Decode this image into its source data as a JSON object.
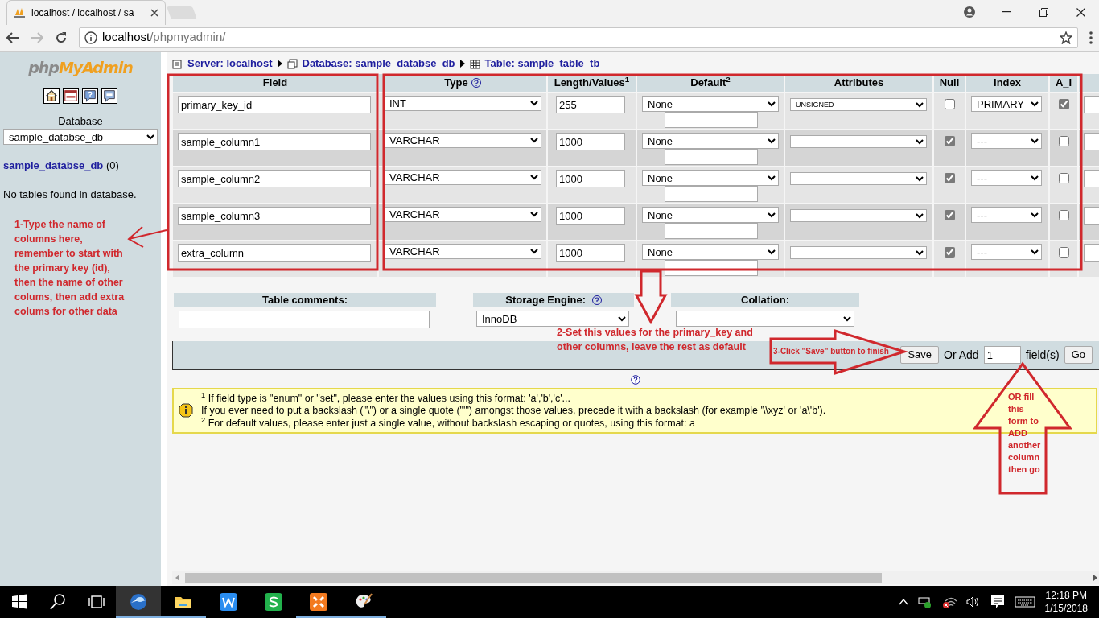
{
  "browser": {
    "tab_title": "localhost / localhost / sa",
    "address_host": "localhost",
    "address_path": "/phpmyadmin/"
  },
  "sidebar": {
    "logo_php": "php",
    "logo_myadmin": "MyAdmin",
    "database_label": "Database",
    "database_value": "sample_databse_db",
    "db_link": "sample_databse_db",
    "db_count": "(0)",
    "empty_note": "No tables found in database."
  },
  "breadcrumb": [
    {
      "kind": "server",
      "label": "Server: localhost"
    },
    {
      "kind": "database",
      "label": "Database: sample_databse_db"
    },
    {
      "kind": "table",
      "label": "Table: sample_table_tb"
    }
  ],
  "table": {
    "columns": [
      {
        "label": "Field",
        "help": false
      },
      {
        "label": "Type",
        "help": true
      },
      {
        "label": "Length/Values$^{1}$",
        "help": false
      },
      {
        "label": "Default$^{2}$",
        "help": false
      },
      {
        "label": "Attributes",
        "help": false
      },
      {
        "label": "Null",
        "help": false
      },
      {
        "label": "Index",
        "help": false
      },
      {
        "label": "A_I",
        "help": false
      }
    ],
    "rows": [
      {
        "field": "primary_key_id",
        "type": "INT",
        "length": "255",
        "default": "None",
        "attributes": "UNSIGNED",
        "null": false,
        "index": "PRIMARY",
        "ai": true
      },
      {
        "field": "sample_column1",
        "type": "VARCHAR",
        "length": "1000",
        "default": "None",
        "null": true,
        "index": "---",
        "ai": false
      },
      {
        "field": "sample_column2",
        "type": "VARCHAR",
        "length": "1000",
        "default": "None",
        "null": true,
        "index": "---",
        "ai": false
      },
      {
        "field": "sample_column3",
        "type": "VARCHAR",
        "length": "1000",
        "default": "None",
        "null": true,
        "index": "---",
        "ai": false
      },
      {
        "field": "extra_column",
        "type": "VARCHAR",
        "length": "1000",
        "default": "None",
        "null": true,
        "index": "---",
        "ai": false
      }
    ]
  },
  "options": {
    "comments_label": "Table comments:",
    "engine_label": "Storage Engine:",
    "engine_value": "InnoDB",
    "collation_label": "Collation:"
  },
  "footer": {
    "save": "Save",
    "or_add": "Or Add",
    "add_count": "1",
    "fields_label": "field(s)",
    "go": "Go"
  },
  "notes": [
    "$^{1}$ If field type is \"enum\" or \"set\", please enter the values using this format: 'a','b','c'...",
    "If you ever need to put a backslash (\"\\\") or a single quote (\"'\") amongst those values, precede it with a backslash (for example '\\\\xyz' or 'a\\'b').",
    "$^{2}$ For default values, please enter just a single value, without backslash escaping or quotes, using this format: a"
  ],
  "annotations": [
    {
      "kind": "columns",
      "text": "1-Type the name of columns here, remember to start with the primary key (id), then the name of other colums, then add extra colums for other data"
    },
    {
      "kind": "values",
      "text": "2-Set this values for the primary_key and other columns, leave the rest as default"
    },
    {
      "kind": "save",
      "text": "3-Click \"Save\" button to finish"
    },
    {
      "kind": "add",
      "text": "OR fill this form to ADD another column then go"
    }
  ],
  "taskbar": {
    "apps": [
      {
        "kind": "browser",
        "running": true,
        "selected": true
      },
      {
        "kind": "folder",
        "running": true,
        "selected": false
      },
      {
        "kind": "writer",
        "running": false,
        "selected": false
      },
      {
        "kind": "sheets",
        "running": false,
        "selected": false
      },
      {
        "kind": "xampp",
        "running": true,
        "selected": false
      },
      {
        "kind": "paint",
        "running": true,
        "selected": false
      }
    ],
    "time": "12:18 PM",
    "date": "1/15/2018"
  }
}
